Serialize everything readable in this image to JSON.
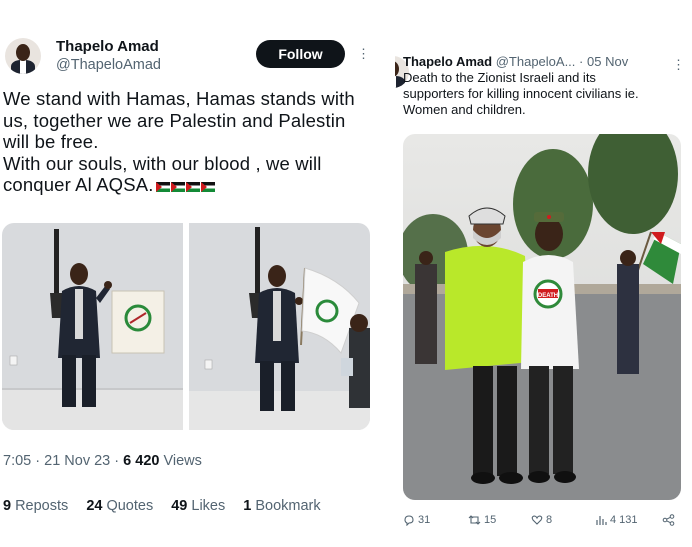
{
  "left_tweet": {
    "display_name": "Thapelo Amad",
    "handle": "@ThapeloAmad",
    "follow_label": "Follow",
    "more_glyph": "⋮",
    "text": "We stand with Hamas, Hamas stands with\nus, together we are Palestin and Palestin\nwill be free.\nWith our souls, with our blood , we will\nconquer Al AQSA.",
    "flag_icon": "palestine-flag-icon",
    "time": "7:05",
    "date": "21 Nov 23",
    "separator": "·",
    "views_count": "6 420",
    "views_label": "Views",
    "reposts_count": "9",
    "reposts_label": "Reposts",
    "quotes_count": "24",
    "quotes_label": "Quotes",
    "likes_count": "49",
    "likes_label": "Likes",
    "bookmarks_count": "1",
    "bookmarks_label": "Bookmark"
  },
  "right_tweet": {
    "display_name": "Thapelo Amad",
    "handle": "@ThapeloA...",
    "separator": "·",
    "date": "05 Nov",
    "more_glyph": "⋮",
    "text": "Death to the Zionist Israeli and its\nsupporters for killing innocent civilians ie.\nWomen and children.",
    "tshirt_text": "DEATH",
    "replies": "31",
    "reposts": "15",
    "likes": "8",
    "views": "4 131"
  },
  "colors": {
    "text_primary": "#0f1419",
    "text_secondary": "#536471",
    "follow_bg": "#0f1419",
    "background": "#ffffff"
  }
}
